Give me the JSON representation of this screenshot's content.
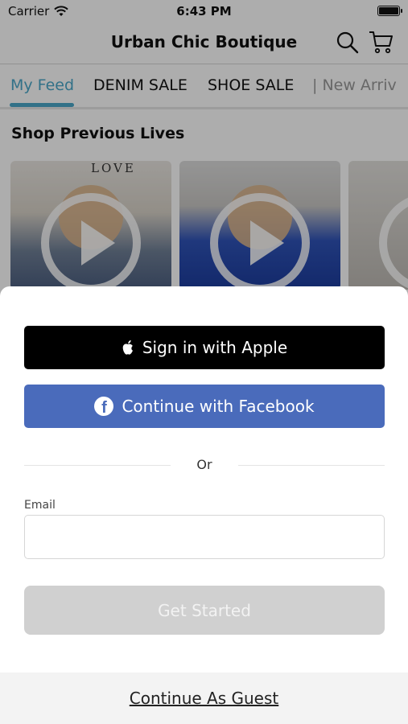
{
  "status_bar": {
    "carrier": "Carrier",
    "time": "6:43 PM"
  },
  "nav": {
    "title": "Urban Chic Boutique",
    "search_icon": "search-icon",
    "cart_icon": "cart-icon"
  },
  "tabs": [
    {
      "label": "My Feed",
      "active": true
    },
    {
      "label": "DENIM SALE",
      "active": false
    },
    {
      "label": "SHOE SALE",
      "active": false
    },
    {
      "label": "| New Arriv",
      "active": false
    }
  ],
  "section": {
    "title": "Shop Previous Lives"
  },
  "thumbnails": [
    {
      "overlay_text": "LOVE"
    },
    {
      "overlay_text": ""
    },
    {
      "overlay_text": ""
    }
  ],
  "sheet": {
    "apple_label": "Sign in with Apple",
    "facebook_label": "Continue with Facebook",
    "or_text": "Or",
    "email_label": "Email",
    "email_value": "",
    "email_placeholder": "",
    "start_label": "Get Started",
    "guest_label": "Continue As Guest"
  },
  "colors": {
    "accent": "#4aa7c9",
    "facebook": "#4a6bbb",
    "apple": "#000000",
    "disabled_button": "#d0d0d0"
  }
}
